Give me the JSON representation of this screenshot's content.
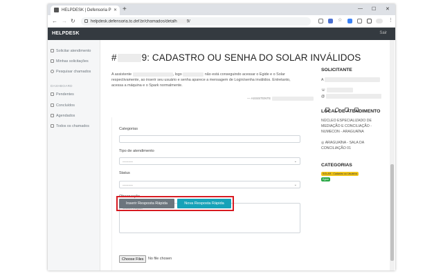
{
  "browser": {
    "tab_title": "HELPDESK | Defensoria P",
    "url_prefix": "helpdesk.defensoria.to.def.br/chamados/detalh",
    "url_suffix": "9/"
  },
  "app": {
    "brand": "HELPDESK",
    "logout": "Sair"
  },
  "sidebar": {
    "items_top": [
      {
        "label": "Solicitar atendimento"
      },
      {
        "label": "Minhas solicitações"
      },
      {
        "label": "Pesquisar chamados"
      }
    ],
    "section_title": "DASHBOARD",
    "items_bottom": [
      {
        "label": "Pendentes"
      },
      {
        "label": "Concluídos"
      },
      {
        "label": "Agendados"
      },
      {
        "label": "Todos os chamados"
      }
    ]
  },
  "ticket": {
    "title_prefix": "#",
    "title_suffix": "9: CADASTRO OU SENHA DO SOLAR INVÁLIDOS",
    "desc_line1_a": "A assistente",
    "desc_line1_b": ", logo",
    "desc_line1_c": "não está conseguindo acessar o Egide e o Solar",
    "desc_line2": "respectivamente, ao inserir seu usuário e senha aparece a mensagem de Login/senha inválidos. Entretanto,",
    "desc_line3": "acessa a máquina e o Spark normalmente.",
    "meta_label": "— ASSISTENTE"
  },
  "form": {
    "categorias_label": "Categorias",
    "tipo_label": "Tipo de atendimento",
    "tipo_value": "---------",
    "status_label": "Status",
    "status_value": "---------",
    "obs_label": "Observação",
    "obs_placeholder": "Observação",
    "btn_inserir": "Inserir Resposta Rápida",
    "btn_nova": "Nova Resposta Rápida",
    "file_button": "Choose Files",
    "file_status": "No file chosen"
  },
  "right_panel": {
    "solicitante_title": "SOLICITANTE",
    "user_prefix": "A",
    "email_prefix": "@",
    "local_title": "LOCAL DE ATENDIMENTO",
    "local_line1": "NÚCLEO ESPECIALIZADO DE",
    "local_line2": "MEDIAÇÃO E CONCILIAÇÃO -",
    "local_line3": "NUMECON - ARAGUAÍNA",
    "local_line4": "ARAGUAÍNA - SALA DA",
    "local_line5": "CONCILIAÇÃO 01",
    "categorias_title": "CATEGORIAS",
    "badge1": "SOLAR - Cadastro ou Usuários",
    "badge2": "Egide"
  },
  "colors": {
    "header_bg": "#343a40",
    "teal": "#17a2b8",
    "gray_btn": "#6c757d",
    "highlight": "#d71920",
    "badge_yellow": "#f0c419",
    "badge_green": "#28a745"
  }
}
